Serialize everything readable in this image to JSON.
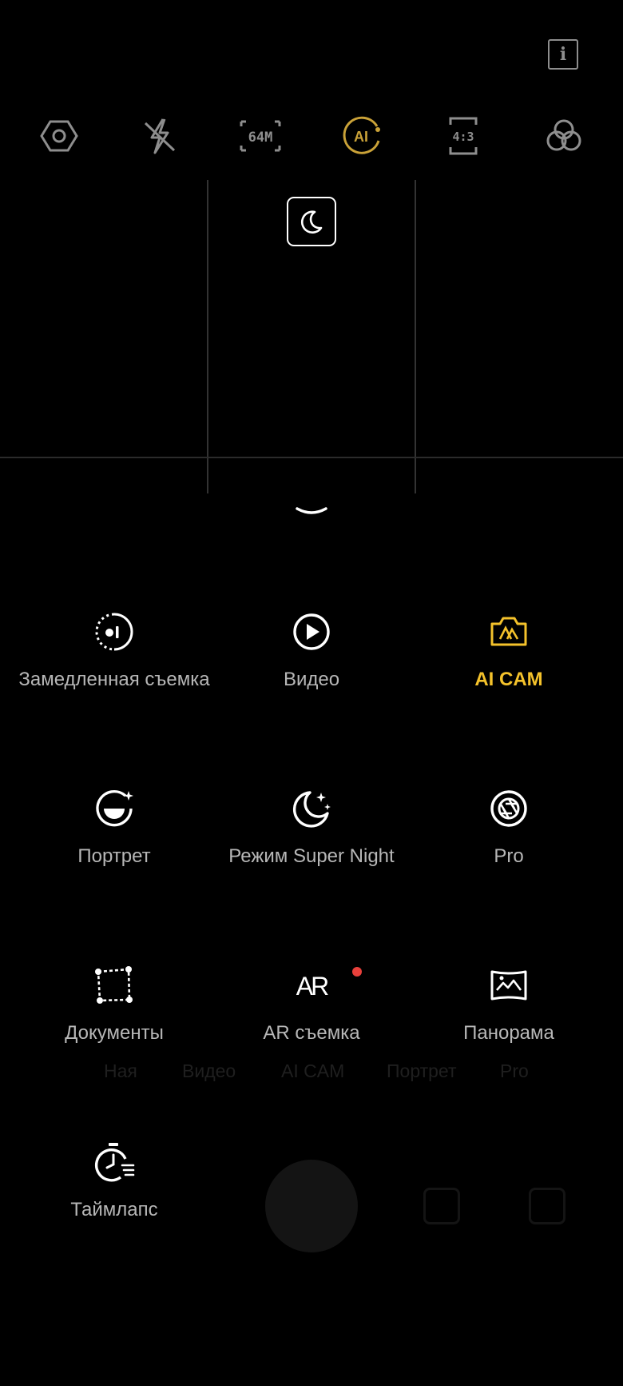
{
  "top_bar": {
    "info_glyph": "i",
    "icons": [
      "settings-hex-icon",
      "flash-off-icon",
      "resolution-icon",
      "ai-icon",
      "aspect-ratio-icon",
      "filters-icon"
    ],
    "resolution_label": "64M",
    "ai_label": "AI",
    "aspect_label": "4:3",
    "ai_color": "#caa238"
  },
  "viewfinder": {
    "night_mode_icon": "moon-icon"
  },
  "modes": [
    {
      "label": "Замедленная съемка",
      "icon": "slow-motion-icon",
      "active": false
    },
    {
      "label": "Видео",
      "icon": "video-play-icon",
      "active": false
    },
    {
      "label": "AI CAM",
      "icon": "ai-cam-icon",
      "active": true
    },
    {
      "label": "Портрет",
      "icon": "portrait-icon",
      "active": false
    },
    {
      "label": "Режим Super Night",
      "icon": "super-night-icon",
      "active": false
    },
    {
      "label": "Pro",
      "icon": "pro-aperture-icon",
      "active": false
    },
    {
      "label": "Документы",
      "icon": "documents-scan-icon",
      "active": false
    },
    {
      "label": "AR съемка",
      "icon": "ar-icon",
      "active": false,
      "badge": true
    },
    {
      "label": "Панорама",
      "icon": "panorama-icon",
      "active": false
    },
    {
      "label": "Таймлапс",
      "icon": "timelapse-icon",
      "active": false
    }
  ],
  "ar_glyph": "AR",
  "background_mode_strip": [
    "Ная",
    "Видео",
    "AI CAM",
    "Портрет",
    "Pro"
  ],
  "colors": {
    "accent": "#f4c22b",
    "label": "#b7b7b7",
    "badge": "#e8403b",
    "icon_gray": "#8e8e8e"
  }
}
